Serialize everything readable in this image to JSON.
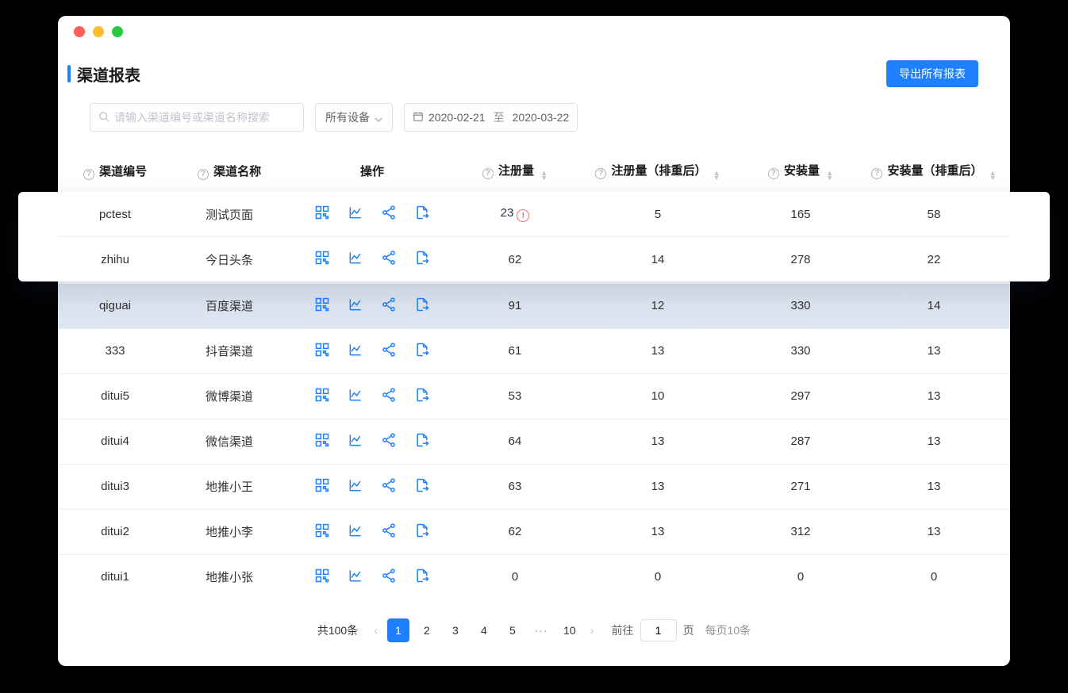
{
  "window": {
    "page_title": "渠道报表",
    "export_label": "导出所有报表"
  },
  "filters": {
    "search_placeholder": "请输入渠道编号或渠道名称搜索",
    "device_label": "所有设备",
    "date_from": "2020-02-21",
    "date_sep": "至",
    "date_to": "2020-03-22"
  },
  "columns": {
    "id": "渠道编号",
    "name": "渠道名称",
    "ops": "操作",
    "m1": "注册量",
    "m2": "注册量（排重后）",
    "m3": "安装量",
    "m4": "安装量（排重后）"
  },
  "rows": [
    {
      "id": "pctest",
      "name": "测试页面",
      "m1": "23",
      "warn": true,
      "m2": "5",
      "m3": "165",
      "m4": "58"
    },
    {
      "id": "zhihu",
      "name": "今日头条",
      "m1": "62",
      "warn": false,
      "m2": "14",
      "m3": "278",
      "m4": "22"
    },
    {
      "id": "qiguai",
      "name": "百度渠道",
      "m1": "91",
      "warn": false,
      "m2": "12",
      "m3": "330",
      "m4": "14",
      "highlight": true
    },
    {
      "id": "333",
      "name": "抖音渠道",
      "m1": "61",
      "warn": false,
      "m2": "13",
      "m3": "330",
      "m4": "13"
    },
    {
      "id": "ditui5",
      "name": "微博渠道",
      "m1": "53",
      "warn": false,
      "m2": "10",
      "m3": "297",
      "m4": "13"
    },
    {
      "id": "ditui4",
      "name": "微信渠道",
      "m1": "64",
      "warn": false,
      "m2": "13",
      "m3": "287",
      "m4": "13"
    },
    {
      "id": "ditui3",
      "name": "地推小王",
      "m1": "63",
      "warn": false,
      "m2": "13",
      "m3": "271",
      "m4": "13"
    },
    {
      "id": "ditui2",
      "name": "地推小李",
      "m1": "62",
      "warn": false,
      "m2": "13",
      "m3": "312",
      "m4": "13"
    },
    {
      "id": "ditui1",
      "name": "地推小张",
      "m1": "0",
      "warn": false,
      "m2": "0",
      "m3": "0",
      "m4": "0"
    }
  ],
  "pagination": {
    "total_label": "共100条",
    "pages": [
      "1",
      "2",
      "3",
      "4",
      "5",
      "10"
    ],
    "active": "1",
    "goto_prefix": "前往",
    "goto_value": "1",
    "goto_suffix": "页",
    "perpage": "每页10条"
  },
  "icons": {
    "help": "?",
    "warn": "!"
  }
}
